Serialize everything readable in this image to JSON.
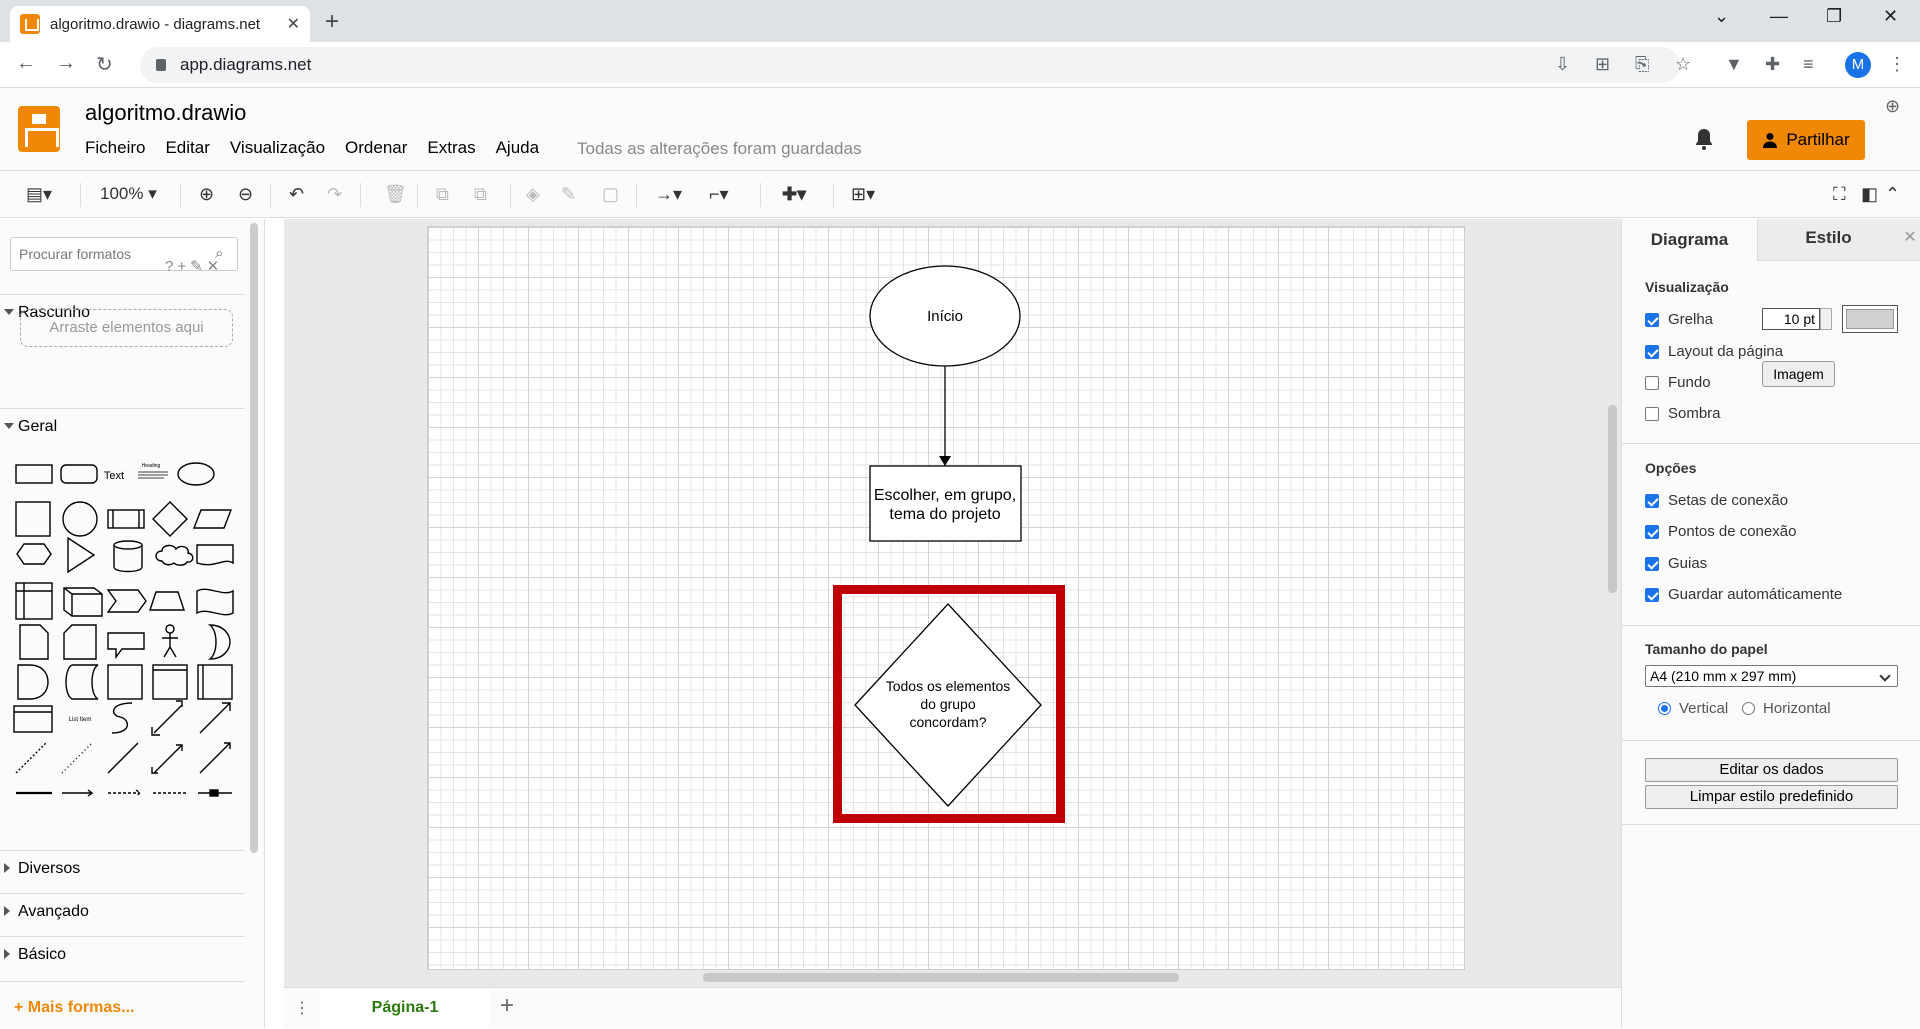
{
  "browser": {
    "tab_title": "algoritmo.drawio - diagrams.net",
    "tab_close": "✕",
    "new_tab": "+",
    "url": "app.diagrams.net",
    "avatar_letter": "M",
    "window_controls": [
      "⌄",
      "—",
      "❐",
      "✕"
    ]
  },
  "app": {
    "doc_title": "algoritmo.drawio",
    "menu": [
      "Ficheiro",
      "Editar",
      "Visualização",
      "Ordenar",
      "Extras",
      "Ajuda"
    ],
    "save_status": "Todas as alterações foram guardadas",
    "share_label": "Partilhar"
  },
  "toolbar": {
    "zoom": "100%"
  },
  "left_panel": {
    "search_placeholder": "Procurar formatos",
    "scratch_title": "Rascunho",
    "scratch_icons": "?+✎✕",
    "dropzone": "Arraste elementos aqui",
    "general_title": "Geral",
    "shape_text_label": "Text",
    "shape_heading_label": "Heading",
    "shape_listitem_label": "List Item",
    "sections": [
      "Diversos",
      "Avançado",
      "Básico"
    ],
    "more_shapes": "+ Mais formas..."
  },
  "diagram": {
    "start_label": "Início",
    "process_label_1": "Escolher, em grupo,",
    "process_label_2": "tema do projeto",
    "decision_label_1": "Todos os elementos",
    "decision_label_2": "do grupo",
    "decision_label_3": "concordam?",
    "highlight_color": "#c00000"
  },
  "pages": {
    "tab": "Página-1",
    "add": "+",
    "menu": "⋮"
  },
  "right_panel": {
    "tab_diagram": "Diagrama",
    "tab_style": "Estilo",
    "close": "✕",
    "section_view": "Visualização",
    "grid": "Grelha",
    "grid_size": "10 pt",
    "page_view": "Layout da página",
    "background": "Fundo",
    "image_button": "Imagem",
    "shadow": "Sombra",
    "section_options": "Opções",
    "options": [
      "Setas de conexão",
      "Pontos de conexão",
      "Guias",
      "Guardar automáticamente"
    ],
    "section_paper": "Tamanho do papel",
    "paper_size": "A4 (210 mm x 297 mm)",
    "orientation_vertical": "Vertical",
    "orientation_horizontal": "Horizontal",
    "edit_data": "Editar os dados",
    "clear_style": "Limpar estilo predefinido"
  },
  "colors": {
    "accent": "#f08705",
    "page_tab_text": "#2b7a0b",
    "checkbox": "#1a73e8"
  }
}
